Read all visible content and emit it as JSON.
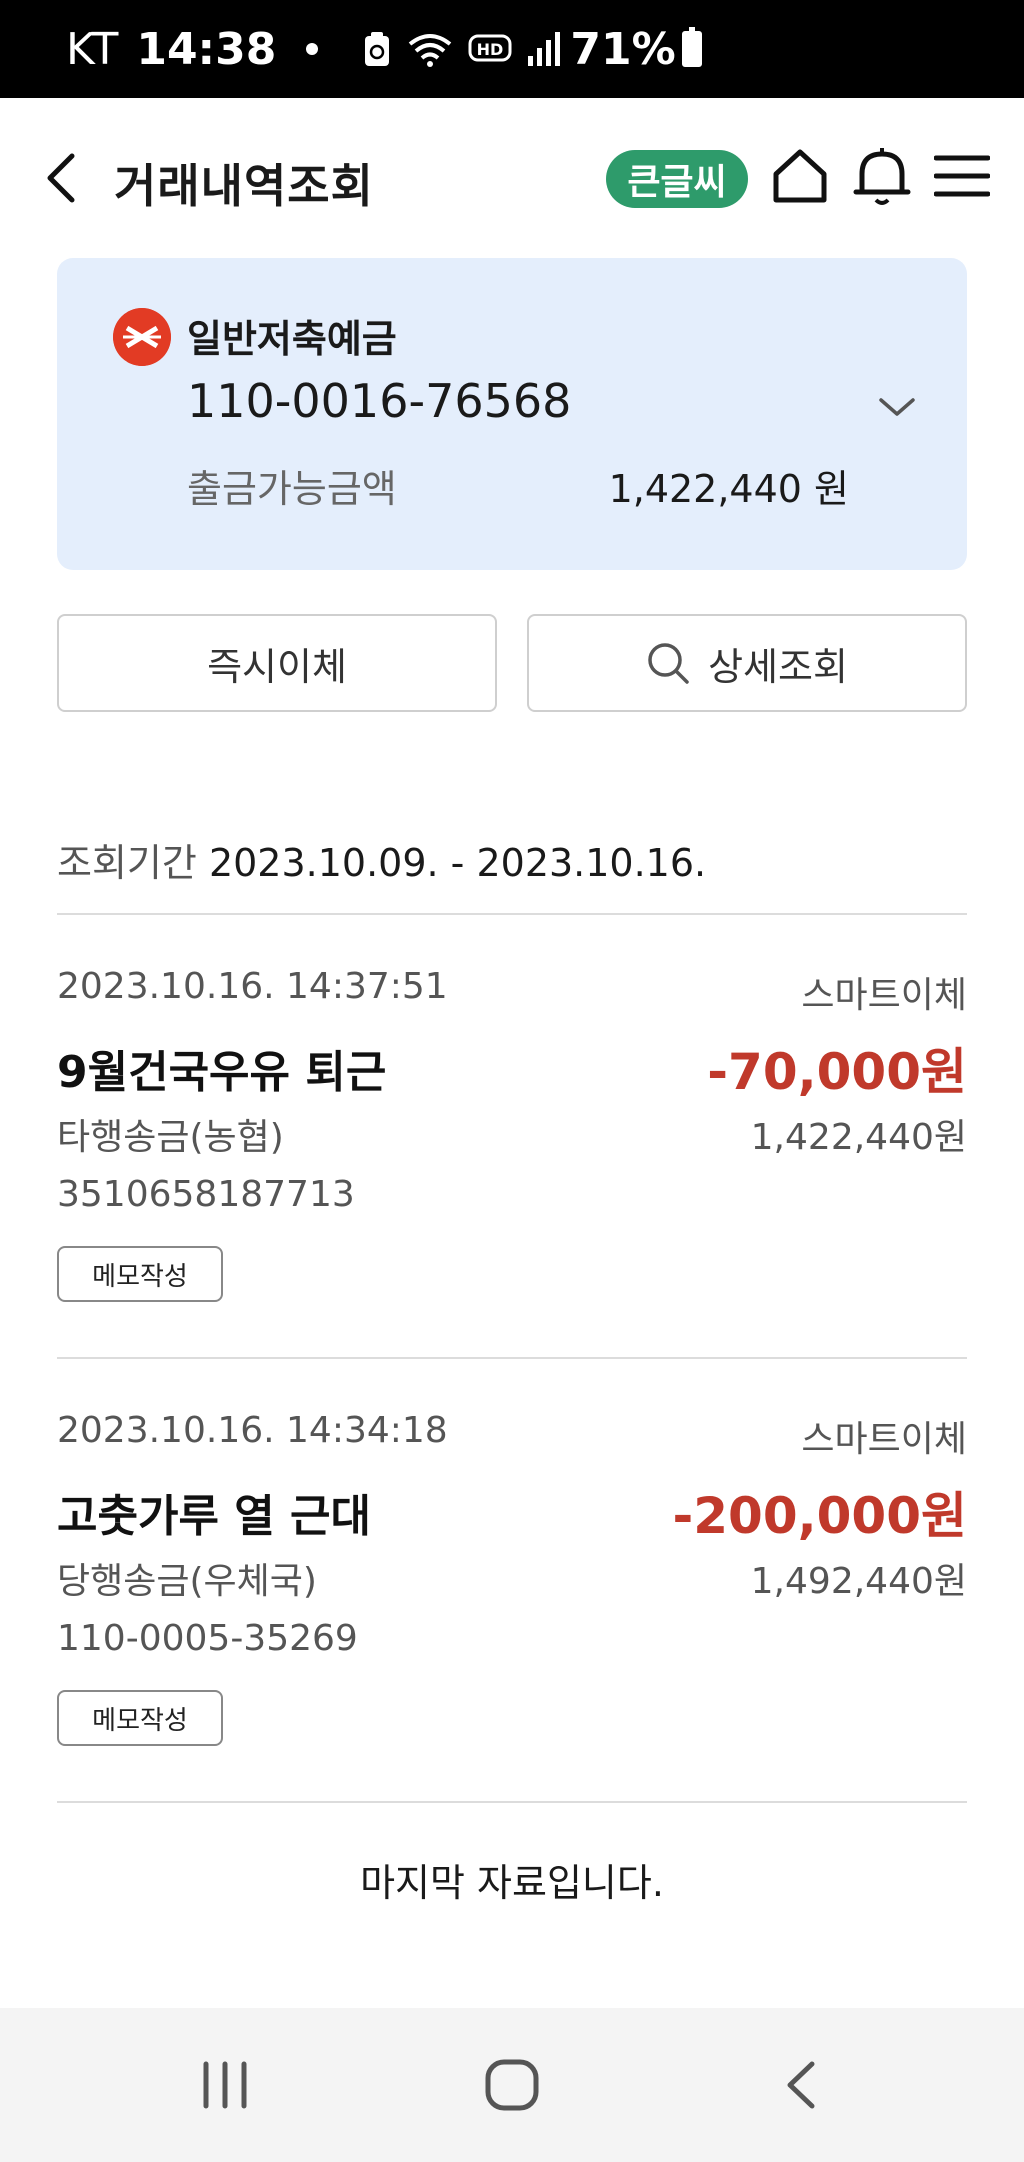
{
  "status_bar": {
    "carrier": "KT",
    "time": "14:38",
    "battery": "71%"
  },
  "header": {
    "title": "거래내역조회",
    "big_font_label": "큰글씨"
  },
  "account": {
    "name": "일반저축예금",
    "number": "110-0016-76568",
    "available_label": "출금가능금액",
    "available_amount": "1,422,440 원"
  },
  "actions": {
    "instant_transfer": "즉시이체",
    "detail_search": "상세조회"
  },
  "period": {
    "label": "조회기간",
    "range": "2023.10.09. - 2023.10.16."
  },
  "transactions": [
    {
      "datetime": "2023.10.16. 14:37:51",
      "type": "스마트이체",
      "memo": "9월건국우유 퇴근",
      "amount": "-70,000원",
      "bank_desc": "타행송금(농협)",
      "balance": "1,422,440원",
      "account": "3510658187713",
      "memo_button": "메모작성"
    },
    {
      "datetime": "2023.10.16. 14:34:18",
      "type": "스마트이체",
      "memo": "고춧가루 열 근대",
      "amount": "-200,000원",
      "bank_desc": "당행송금(우체국)",
      "balance": "1,492,440원",
      "account": "110-0005-35269",
      "memo_button": "메모작성"
    }
  ],
  "end_message": "마지막 자료입니다.",
  "colors": {
    "accent_green": "#2e9b6b",
    "card_bg": "#e4eefc",
    "amount_red": "#c0392b",
    "logo_red": "#e23b24"
  },
  "icons": [
    "back-icon",
    "home-icon",
    "bell-icon",
    "menu-icon",
    "chevron-down-icon",
    "search-icon",
    "post-office-logo"
  ]
}
